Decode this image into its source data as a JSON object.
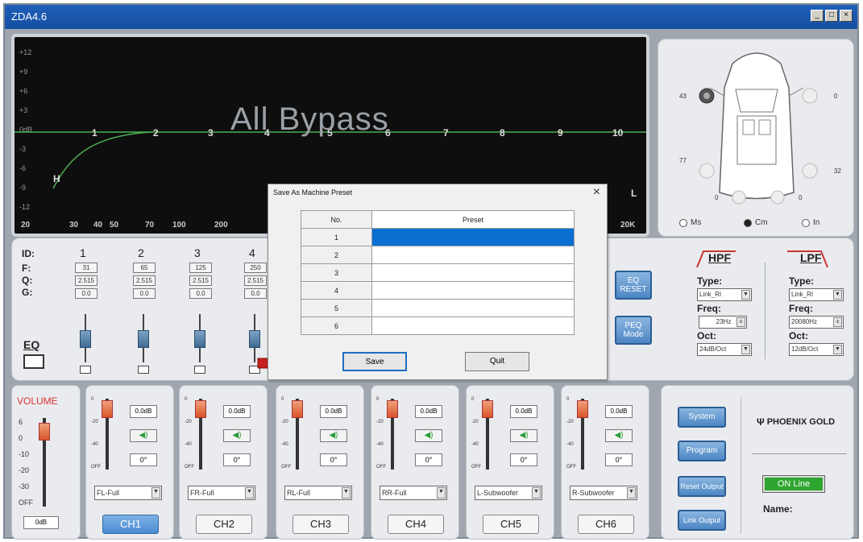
{
  "window": {
    "title": "ZDA4.6",
    "controls": [
      "_",
      "□",
      "×"
    ]
  },
  "graph": {
    "overlay_text": "All Bypass",
    "y_labels": [
      "+12",
      "+9",
      "+6",
      "+3",
      "0dB",
      "-3",
      "-6",
      "-9",
      "-12"
    ],
    "x_labels": [
      "20",
      "30",
      "40",
      "50",
      "70",
      "100",
      "200",
      "20K"
    ],
    "band_markers": [
      "1",
      "2",
      "3",
      "4",
      "5",
      "6",
      "7",
      "8",
      "9",
      "10"
    ],
    "hpf_marker": "H",
    "lpf_marker": "L",
    "colors": {
      "curve": "#4caf50",
      "grid": "#2a2a2a"
    }
  },
  "speaker_map": {
    "distances": {
      "fl": "43",
      "fr": "0",
      "rl": "77",
      "rr": "32",
      "sub_l": "0",
      "sub_r": "0"
    },
    "units": [
      {
        "label": "Ms",
        "selected": false
      },
      {
        "label": "Cm",
        "selected": true
      },
      {
        "label": "In",
        "selected": false
      }
    ]
  },
  "eq": {
    "row_labels": {
      "id": "ID:",
      "f": "F:",
      "q": "Q:",
      "g": "G:"
    },
    "bands": [
      {
        "id": "1",
        "f": "31",
        "q": "2.515",
        "g": "0.0"
      },
      {
        "id": "2",
        "f": "65",
        "q": "2.515",
        "g": "0.0"
      },
      {
        "id": "3",
        "f": "125",
        "q": "2.515",
        "g": "0.0"
      },
      {
        "id": "4",
        "f": "250",
        "q": "2.515",
        "g": "0.0"
      }
    ],
    "eq_label": "EQ",
    "eq_reset_label": "EQ RESET",
    "peq_mode_label": "PEQ Mode"
  },
  "hpf": {
    "title": "HPF",
    "type_label": "Type:",
    "type_value": "Link_RI",
    "freq_label": "Freq:",
    "freq_value": "23Hz",
    "oct_label": "Oct:",
    "oct_value": "24dB/Oct"
  },
  "lpf": {
    "title": "LPF",
    "type_label": "Type:",
    "type_value": "Link_RI",
    "freq_label": "Freq:",
    "freq_value": "20080Hz",
    "oct_label": "Oct:",
    "oct_value": "12dB/Oct"
  },
  "volume": {
    "label": "VOLUME",
    "scale": [
      "6",
      "0",
      "-10",
      "-20",
      "-30",
      "OFF"
    ],
    "value": "0dB"
  },
  "channels": [
    {
      "name": "CH1",
      "gain": "0.0dB",
      "phase": "0°",
      "output": "FL-Full",
      "active": true
    },
    {
      "name": "CH2",
      "gain": "0.0dB",
      "phase": "0°",
      "output": "FR-Full",
      "active": false
    },
    {
      "name": "CH3",
      "gain": "0.0dB",
      "phase": "0°",
      "output": "RL-Full",
      "active": false
    },
    {
      "name": "CH4",
      "gain": "0.0dB",
      "phase": "0°",
      "output": "RR-Full",
      "active": false
    },
    {
      "name": "CH5",
      "gain": "0.0dB",
      "phase": "0°",
      "output": "L-Subwoofer",
      "active": false
    },
    {
      "name": "CH6",
      "gain": "0.0dB",
      "phase": "0°",
      "output": "R-Subwoofer",
      "active": false
    }
  ],
  "channel_scale": [
    "0",
    "-20",
    "-40",
    "OFF"
  ],
  "side": {
    "system": "System",
    "program": "Program",
    "reset_output": "Reset Output",
    "link_output": "Link Output",
    "brand": "PHOENIX GOLD",
    "status": "ON Line",
    "name_label": "Name:"
  },
  "dialog": {
    "title": "Save As Machine Preset",
    "col_no": "No.",
    "col_preset": "Preset",
    "rows": [
      "1",
      "2",
      "3",
      "4",
      "5",
      "6"
    ],
    "save_label": "Save",
    "quit_label": "Quit"
  }
}
